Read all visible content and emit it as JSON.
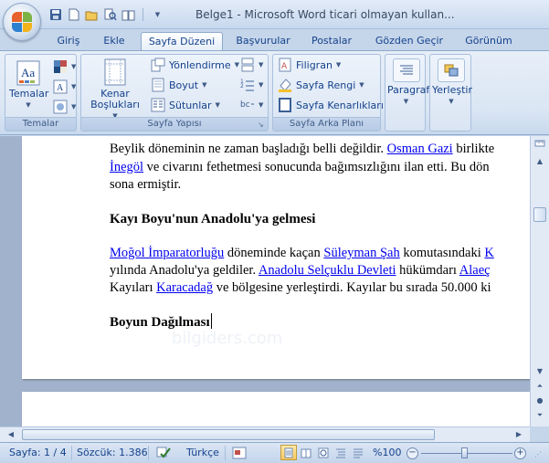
{
  "titlebar": {
    "title": "Belge1 - Microsoft Word ticari olmayan kullan...",
    "qat": [
      "save-icon",
      "new-icon",
      "open-icon",
      "print-preview-icon",
      "dictionary-icon",
      "qat-dropdown-icon"
    ]
  },
  "tabs": [
    "Giriş",
    "Ekle",
    "Sayfa Düzeni",
    "Başvurular",
    "Postalar",
    "Gözden Geçir",
    "Görünüm"
  ],
  "active_tab": "Sayfa Düzeni",
  "ribbon": {
    "temalar": {
      "button": "Temalar",
      "group_label": "Temalar"
    },
    "sayfa_yapisi": {
      "margins": "Kenar Boşlukları",
      "orientation": "Yönlendirme",
      "size": "Boyut",
      "columns": "Sütunlar",
      "group_label": "Sayfa Yapısı"
    },
    "arka_plan": {
      "watermark": "Filigran",
      "page_color": "Sayfa Rengi",
      "page_borders": "Sayfa Kenarlıkları",
      "group_label": "Sayfa Arka Planı"
    },
    "paragraph": "Paragraf",
    "arrange": "Yerleştir"
  },
  "document": {
    "line1_pre": "Beylik döneminin ne zaman başladığı belli değildir. ",
    "line1_link": "Osman Gazi",
    "line1_post": " birlikte",
    "line2_link": "İnegöl",
    "line2_post": " ve civarını fethetmesi sonucunda bağımsızlığını ilan etti. Bu dön",
    "line3": "sona ermiştir.",
    "heading1": "Kayı Boyu'nun Anadolu'ya gelmesi",
    "p2_l1_link1": "Moğol İmparatorluğu",
    "p2_l1_mid": " döneminde kaçan ",
    "p2_l1_link2": "Süleyman Şah",
    "p2_l1_post": " komutasındaki ",
    "p2_l1_link3": "K",
    "p2_l2_pre": "yılında Anadolu'ya geldiler. ",
    "p2_l2_link1": "Anadolu Selçuklu Devleti",
    "p2_l2_mid": " hükümdarı ",
    "p2_l2_link2": "Alaeç",
    "p2_l3_pre": "Kayıları ",
    "p2_l3_link": "Karacadağ",
    "p2_l3_post": " ve bölgesine yerleştirdi. Kayılar bu sırada 50.000 ki",
    "heading2": "Boyun Dağılması",
    "watermark": "bilgiders.com"
  },
  "statusbar": {
    "page": "Sayfa: 1 / 4",
    "words": "Sözcük: 1.386",
    "language": "Türkçe",
    "zoom": "%100"
  },
  "colors": {
    "link": "#0000ee",
    "ribbon": "#dbe6f4",
    "accent": "#15428b"
  }
}
